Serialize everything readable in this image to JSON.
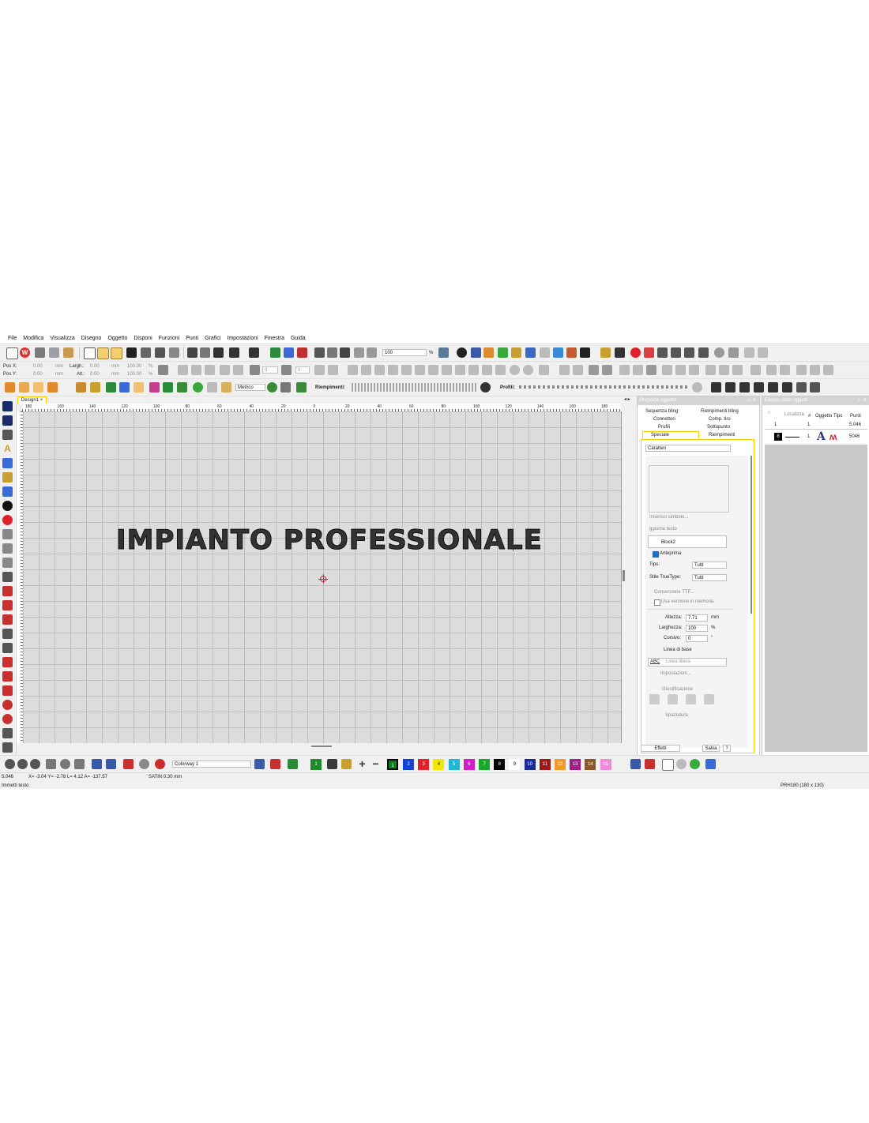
{
  "menu": [
    "File",
    "Modifica",
    "Visualizza",
    "Disegno",
    "Oggetto",
    "Disponi",
    "Funzioni",
    "Punti",
    "Grafici",
    "Impostazioni",
    "Finestra",
    "Guida"
  ],
  "toolbar1": {
    "zoom_value": "100",
    "zoom_unit": "%"
  },
  "toolbar2": {
    "posx_label": "Pos X:",
    "posx_value": "0.00",
    "posx_unit": "mm",
    "posy_label": "Pos Y:",
    "posy_value": "0.00",
    "posy_unit": "mm",
    "width_label": "Largh.:",
    "width_value": "0.00",
    "width_unit": "mm",
    "width_pct": "100.00",
    "width_pct_unit": "%",
    "height_label": "Alt.:",
    "height_value": "0.00",
    "height_unit": "mm",
    "height_pct": "100.00",
    "height_pct_unit": "%",
    "rotate_value": "0",
    "slant_value": "0"
  },
  "toolbar3": {
    "units_select": "Metrico",
    "fills_label": "Riempimenti:",
    "profiles_label": "Profili:"
  },
  "document": {
    "tab_label": "Design1",
    "tab_close": "×"
  },
  "ruler": {
    "h_ticks": [
      "180",
      "160",
      "140",
      "120",
      "100",
      "80",
      "60",
      "40",
      "20",
      "0",
      "20",
      "40",
      "60",
      "80",
      "100",
      "120",
      "140",
      "160",
      "180"
    ]
  },
  "canvas_text": "IMPIANTO PROFESSIONALE",
  "props": {
    "title": "Proprietà oggetto",
    "tabs": [
      "Sequenza bling",
      "Riempimenti bling",
      "Connettori",
      "Comp. tiro",
      "Profili",
      "Sottopunto",
      "Speciale",
      "Riempimenti"
    ],
    "charset_select": "Caratteri",
    "insert_symbol": "Inserisci simbolo...",
    "update_text": "ggiorna testo",
    "font_select": "Block2",
    "preview_label": "Anteprima",
    "type_label": "Tipo:",
    "type_value": "Tutti",
    "tt_style_label": "Stile TrueType:",
    "tt_style_value": "Tutti",
    "ttf_conversion": "Conversione TTF...",
    "use_memory_label": "Usa versione in memoria",
    "height_label": "Altezza:",
    "height_value": "7.71",
    "height_unit": "mm",
    "width_label": "Larghezza:",
    "width_value": "100",
    "width_unit": "%",
    "italic_label": "Corsivo:",
    "italic_value": "0",
    "italic_unit": "°",
    "baseline_label": "Linea di base",
    "baseline_sample": "ABC",
    "baseline_value": "Linea libera",
    "settings_label": "Impostazioni...",
    "justify_label": "Giustificazione",
    "spacing_label": "Spaziatura",
    "effects_button": "Effetti",
    "save_button": "Salva",
    "help_button": "?"
  },
  "colorlist": {
    "title": "Elenco colori-oggetti",
    "columns": [
      "Localizza",
      "#",
      "Oggetto",
      "Tipo",
      "Punti"
    ],
    "rows": [
      {
        "n": "1",
        "obj": "1",
        "points": "5.046"
      },
      {
        "n": "1",
        "obj": "1",
        "badge": "8",
        "type": "A",
        "points": "5046"
      }
    ]
  },
  "palette": {
    "colorway": "Colorway 1",
    "swatches": [
      {
        "label": "1",
        "color": "#1e8a2a"
      },
      {
        "label": "1",
        "color": "#0a7d1e"
      },
      {
        "label": "2",
        "color": "#1242d8"
      },
      {
        "label": "3",
        "color": "#e0202a"
      },
      {
        "label": "4",
        "color": "#f2e600"
      },
      {
        "label": "5",
        "color": "#1fb7d8"
      },
      {
        "label": "6",
        "color": "#d21ec8"
      },
      {
        "label": "7",
        "color": "#18a82a"
      },
      {
        "label": "8",
        "color": "#000000"
      },
      {
        "label": "9",
        "color": "#ffffff"
      },
      {
        "label": "10",
        "color": "#1a2a9a"
      },
      {
        "label": "11",
        "color": "#9a1a1a"
      },
      {
        "label": "12",
        "color": "#f29a28"
      },
      {
        "label": "13",
        "color": "#a01d8a"
      },
      {
        "label": "14",
        "color": "#8a5a2a"
      },
      {
        "label": "15",
        "color": "#f08ad8"
      }
    ]
  },
  "status": {
    "count": "5.046",
    "coords": "X= -3.04 Y= -2.78 L= 4.12 A= -137.57",
    "stitch": "SATIN 0.30 mm",
    "mode": "Immetti testo",
    "hoop": "PRH180 (180 x 130)"
  },
  "colors": {
    "accent": "#ffcc00",
    "canvas": "#dcdcdc",
    "header": "#d4d4d4"
  }
}
